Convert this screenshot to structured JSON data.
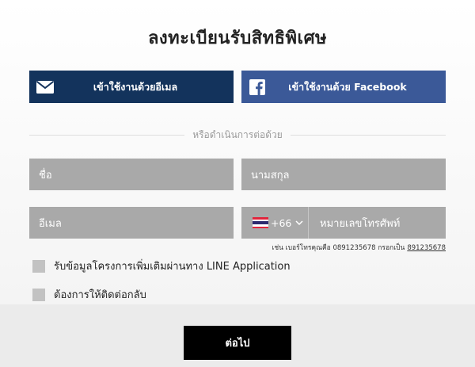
{
  "header": {
    "title": "ลงทะเบียนรับสิทธิพิเศษ"
  },
  "login": {
    "email_label": "เข้าใช้งานด้วยอีเมล",
    "facebook_label": "เข้าใช้งานด้วย Facebook"
  },
  "divider": {
    "text": "หรือดำเนินการต่อด้วย"
  },
  "form": {
    "first_name_placeholder": "ชื่อ",
    "last_name_placeholder": "นามสกุล",
    "email_placeholder": "อีเมล",
    "country_code": "+66",
    "phone_placeholder": "หมายเลขโทรศัพท์",
    "phone_hint_prefix": "เช่น เบอร์โทรคุณคือ 0891235678 กรอกเป็น",
    "phone_hint_example": "891235678"
  },
  "options": {
    "line_label": "รับข้อมูลโครงการเพิ่มเติมผ่านทาง LINE Application",
    "callback_label": "ต้องการให้ติดต่อกลับ"
  },
  "actions": {
    "next_label": "ต่อไป"
  },
  "colors": {
    "email_button": "#13335c",
    "facebook_button": "#3b5998",
    "field_bg": "#a9a9a9",
    "next_button": "#000000"
  },
  "icons": {
    "email": "envelope-icon",
    "facebook": "facebook-icon",
    "flag": "thailand-flag-icon",
    "dropdown": "chevron-down-icon"
  }
}
